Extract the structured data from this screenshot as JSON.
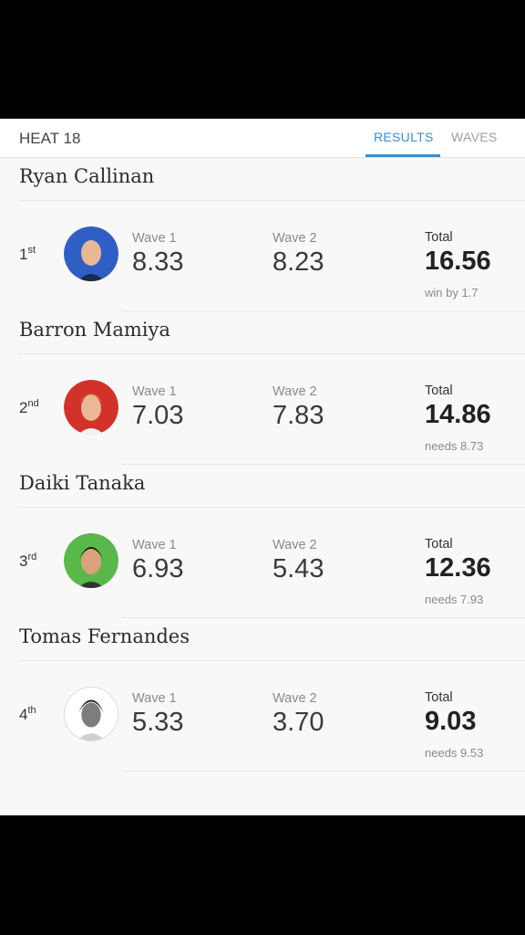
{
  "header": {
    "title": "HEAT 18",
    "tabs": [
      {
        "label": "RESULTS",
        "active": true
      },
      {
        "label": "WAVES",
        "active": false
      }
    ]
  },
  "colors": {
    "accent": "#3b8ed3"
  },
  "surfers": [
    {
      "name": "Ryan Callinan",
      "rank": "1",
      "rank_suffix": "st",
      "wave1_label": "Wave 1",
      "wave1": "8.33",
      "wave2_label": "Wave 2",
      "wave2": "8.23",
      "total_label": "Total",
      "total": "16.56",
      "status": "win by 1.7",
      "avatar_color": "#2f5fc4"
    },
    {
      "name": "Barron Mamiya",
      "rank": "2",
      "rank_suffix": "nd",
      "wave1_label": "Wave 1",
      "wave1": "7.03",
      "wave2_label": "Wave 2",
      "wave2": "7.83",
      "total_label": "Total",
      "total": "14.86",
      "status": "needs 8.73",
      "avatar_color": "#d3322b"
    },
    {
      "name": "Daiki Tanaka",
      "rank": "3",
      "rank_suffix": "rd",
      "wave1_label": "Wave 1",
      "wave1": "6.93",
      "wave2_label": "Wave 2",
      "wave2": "5.43",
      "total_label": "Total",
      "total": "12.36",
      "status": "needs 7.93",
      "avatar_color": "#58b84a"
    },
    {
      "name": "Tomas Fernandes",
      "rank": "4",
      "rank_suffix": "th",
      "wave1_label": "Wave 1",
      "wave1": "5.33",
      "wave2_label": "Wave 2",
      "wave2": "3.70",
      "total_label": "Total",
      "total": "9.03",
      "status": "needs 9.53",
      "avatar_color": "#ffffff"
    }
  ]
}
